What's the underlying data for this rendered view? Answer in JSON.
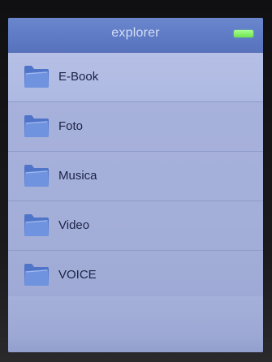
{
  "header": {
    "title": "explorer",
    "battery_color": "#7ef05a"
  },
  "list": {
    "items": [
      {
        "label": "E-Book",
        "icon": "folder-icon",
        "selected": true
      },
      {
        "label": "Foto",
        "icon": "folder-icon",
        "selected": false
      },
      {
        "label": "Musica",
        "icon": "folder-icon",
        "selected": false
      },
      {
        "label": "Video",
        "icon": "folder-icon",
        "selected": false
      },
      {
        "label": "VOICE",
        "icon": "folder-icon",
        "selected": false
      }
    ]
  },
  "colors": {
    "titlebar": "#5f7bc6",
    "list_background": "#a6b1db",
    "selected_row": "#b2bde4",
    "text": "#1b2345"
  }
}
